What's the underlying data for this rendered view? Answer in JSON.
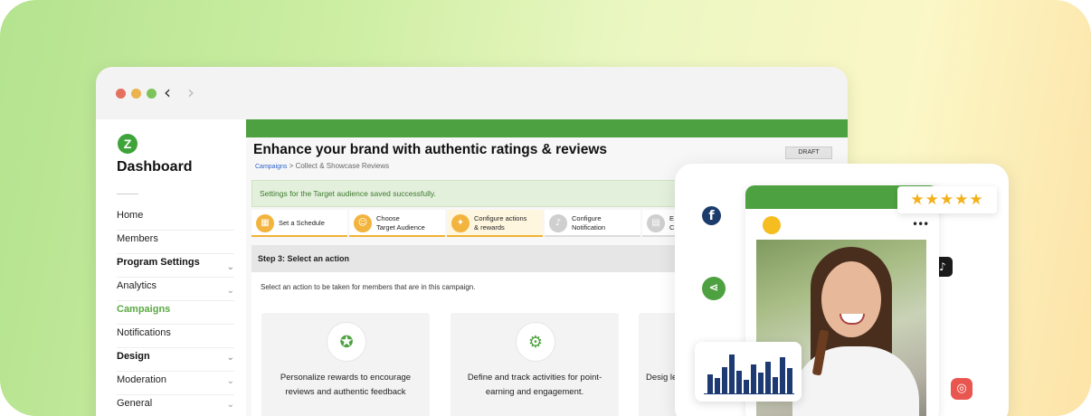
{
  "sidebar": {
    "title": "Dashboard",
    "logo_letter": "Z",
    "items": [
      {
        "label": "Home"
      },
      {
        "label": "Members"
      },
      {
        "label": "Program Settings"
      },
      {
        "label": "Analytics"
      },
      {
        "label": "Campaigns"
      },
      {
        "label": "Notifications"
      },
      {
        "label": "Design"
      },
      {
        "label": "Moderation"
      },
      {
        "label": "General"
      }
    ]
  },
  "header": {
    "title": "Enhance your brand with authentic ratings & reviews",
    "breadcrumb_link": "Campaigns",
    "breadcrumb_sep": ">",
    "breadcrumb_current": "Collect & Showcase Reviews",
    "status_badge": "DRAFT"
  },
  "alert": {
    "message": "Settings for the Target audience saved successfully."
  },
  "steps": [
    {
      "line1": "Set a Schedule",
      "line2": ""
    },
    {
      "line1": "Choose",
      "line2": "Target Audience"
    },
    {
      "line1": "Configure actions",
      "line2": "& rewards"
    },
    {
      "line1": "Configure",
      "line2": "Notification"
    },
    {
      "line1": "E",
      "line2": "C"
    }
  ],
  "section": {
    "heading": "Step 3: Select an action",
    "description": "Select an action to be taken for members that are in this campaign."
  },
  "cards": [
    {
      "text": "Personalize rewards to encourage reviews and authentic feedback"
    },
    {
      "text": "Define and track activities for point-earning and engagement."
    },
    {
      "text": "Desig lev"
    }
  ],
  "social": {
    "rating_stars": "★★★★★",
    "post_menu": "•••",
    "chart_bars": [
      0.45,
      0.38,
      0.62,
      0.92,
      0.55,
      0.33,
      0.68,
      0.5,
      0.74,
      0.4,
      0.86,
      0.6
    ]
  },
  "colors": {
    "brand_green": "#4ea140",
    "accent_orange": "#f3b43d",
    "chart_navy": "#1e3a73"
  }
}
